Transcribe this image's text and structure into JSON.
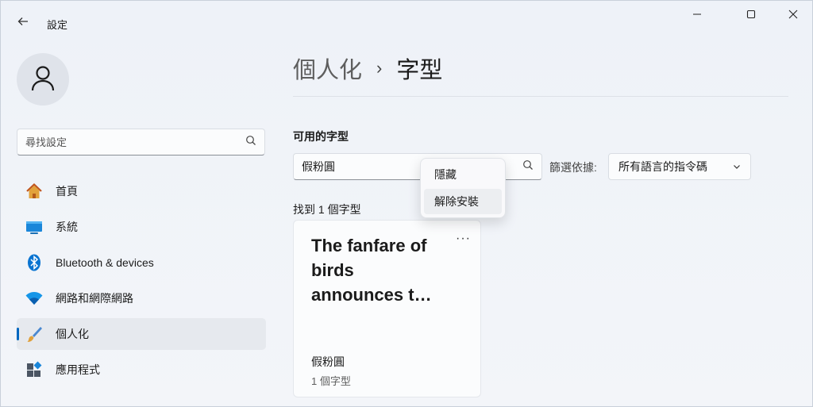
{
  "window": {
    "title": "設定",
    "icons": {
      "back": "back-arrow-icon",
      "minimize": "minimize-icon",
      "maximize": "maximize-icon",
      "close": "close-icon"
    }
  },
  "sidebar": {
    "avatar_icon": "user-icon",
    "search": {
      "placeholder": "尋找設定",
      "icon": "search-icon"
    },
    "items": [
      {
        "label": "首頁",
        "icon": "home-icon",
        "active": false
      },
      {
        "label": "系統",
        "icon": "system-icon",
        "active": false
      },
      {
        "label": "Bluetooth & devices",
        "icon": "bluetooth-icon",
        "active": false
      },
      {
        "label": "網路和網際網路",
        "icon": "wifi-icon",
        "active": false
      },
      {
        "label": "個人化",
        "icon": "brush-icon",
        "active": true
      },
      {
        "label": "應用程式",
        "icon": "apps-icon",
        "active": false
      }
    ]
  },
  "main": {
    "breadcrumb": {
      "parent": "個人化",
      "separator": "›",
      "current": "字型"
    },
    "section_title": "可用的字型",
    "font_search": {
      "value": "假粉圓",
      "icon": "search-icon"
    },
    "filter": {
      "label": "篩選依據:",
      "value": "所有語言的指令碼"
    },
    "found_count": "找到 1 個字型",
    "font_card": {
      "preview_text": "The fanfare of birds announces t…",
      "more": "···",
      "name": "假粉圓",
      "count": "1 個字型"
    },
    "context_menu": {
      "items": [
        "隱藏",
        "解除安裝"
      ]
    }
  },
  "colors": {
    "accent": "#0067c0",
    "background": "#f1f4f9"
  }
}
